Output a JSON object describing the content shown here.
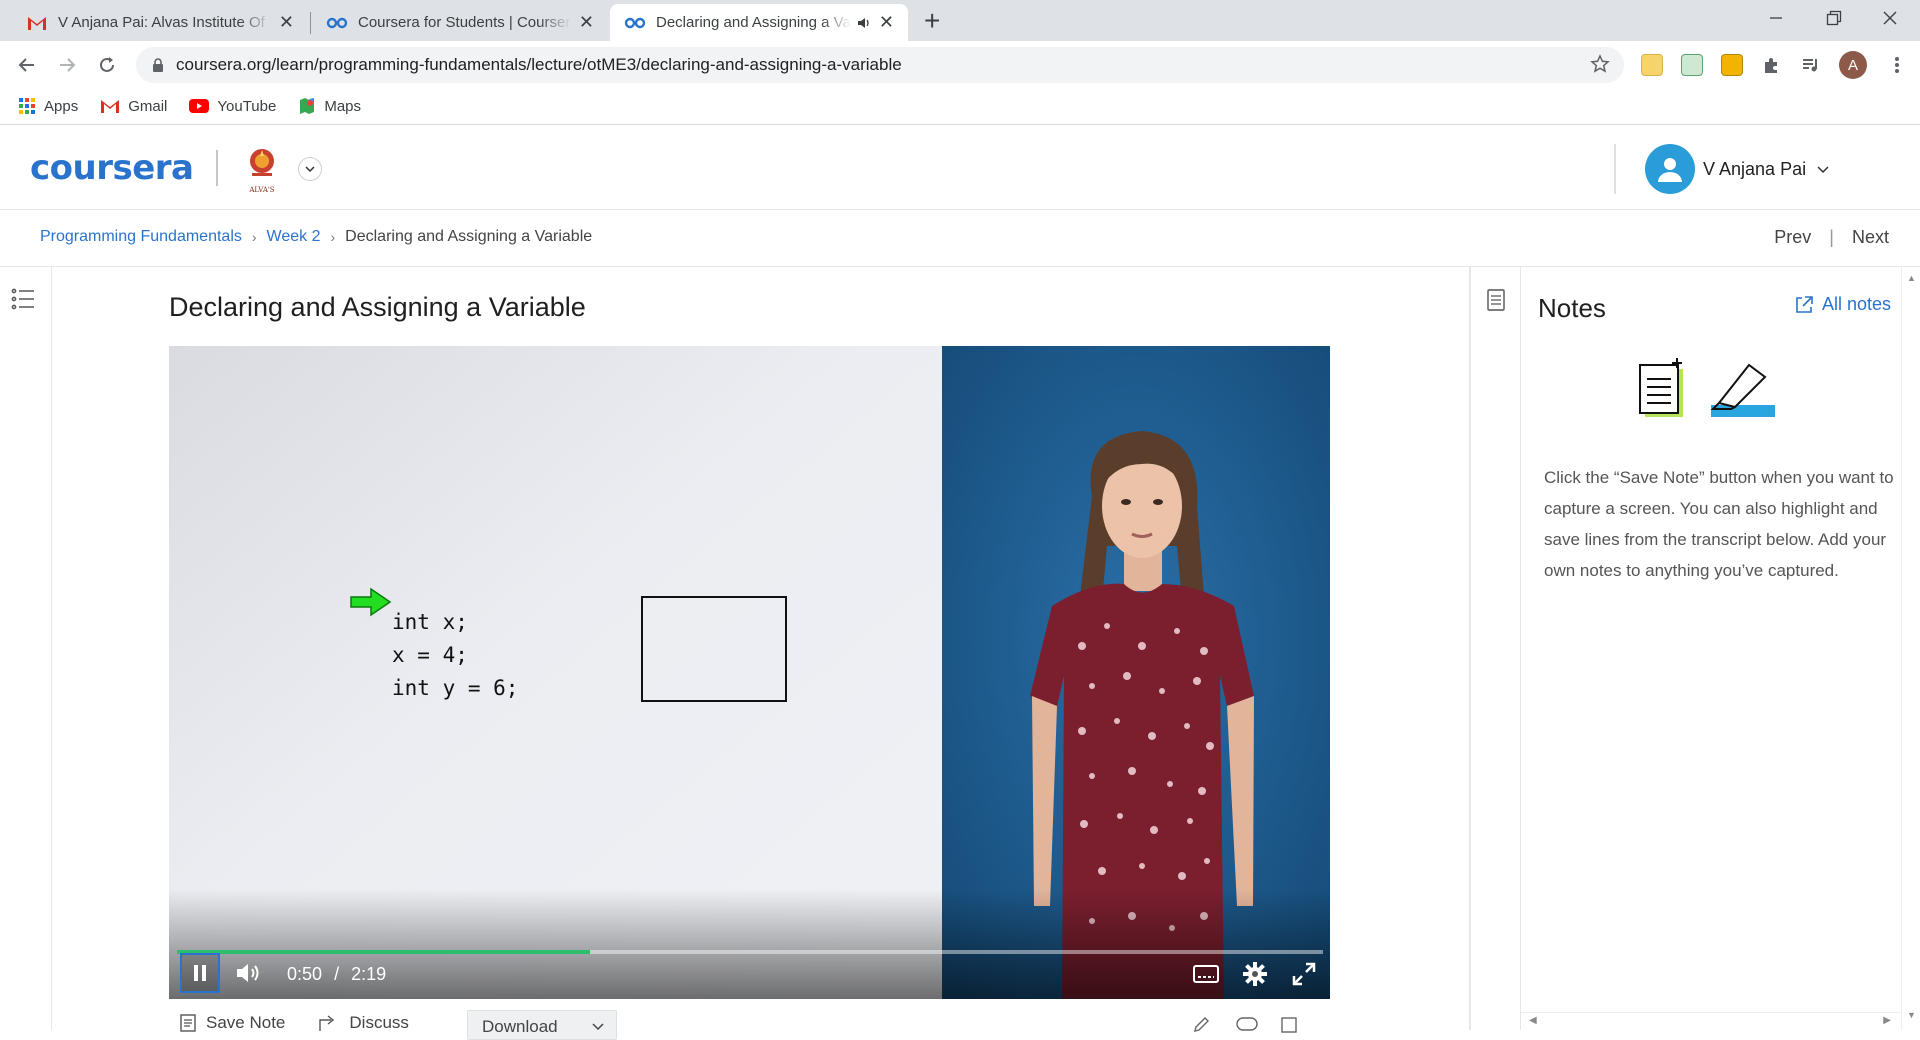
{
  "browser": {
    "tabs": [
      {
        "title": "V Anjana Pai: Alvas Institute Of Engineering",
        "icon": "gmail-icon"
      },
      {
        "title": "Coursera for Students | Coursera",
        "icon": "coursera-icon"
      },
      {
        "title": "Declaring and Assigning a Variable",
        "icon": "coursera-icon",
        "active": true
      }
    ],
    "close_glyph": "✕",
    "new_tab_glyph": "+",
    "url": "coursera.org/learn/programming-fundamentals/lecture/otME3/declaring-and-assigning-a-variable",
    "profile_initial": "A",
    "bookmarks": [
      {
        "label": "Apps",
        "icon": "apps-grid-icon"
      },
      {
        "label": "Gmail",
        "icon": "gmail-icon"
      },
      {
        "label": "YouTube",
        "icon": "youtube-icon"
      },
      {
        "label": "Maps",
        "icon": "maps-icon"
      }
    ]
  },
  "header": {
    "logo": "coursera",
    "institution_logo_text": "ALVA'S",
    "user_name": "V Anjana Pai"
  },
  "breadcrumb": {
    "items": [
      "Programming Fundamentals",
      "Week 2"
    ],
    "current": "Declaring and Assigning a Variable",
    "prev": "Prev",
    "next": "Next"
  },
  "lecture": {
    "title": "Declaring and Assigning a Variable",
    "code_lines": [
      "int x;",
      "x = 4;",
      "int y = 6;"
    ],
    "player": {
      "current_time": "0:50",
      "separator": "/",
      "duration": "2:19",
      "progress_fraction": 0.36
    },
    "actions": {
      "save_note": "Save Note",
      "discuss": "Discuss",
      "download": "Download"
    }
  },
  "notes": {
    "title": "Notes",
    "all_notes": "All notes",
    "description": "Click the “Save Note” button when you want to capture a screen. You can also highlight and save lines from the transcript below. Add your own notes to anything you’ve captured."
  },
  "colors": {
    "brand_blue": "#2a73cc",
    "progress_green": "#2dbd6e",
    "presenter_bg": "#1e5f96"
  }
}
